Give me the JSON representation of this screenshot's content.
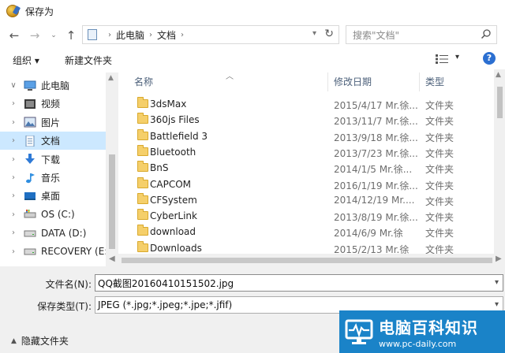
{
  "window": {
    "title": "保存为"
  },
  "address": {
    "segments": [
      "此电脑",
      "文档"
    ]
  },
  "search": {
    "placeholder": "搜索\"文档\""
  },
  "toolbar": {
    "organize_label": "组织 ▾",
    "new_folder_label": "新建文件夹"
  },
  "nav": {
    "items": [
      {
        "label": "此电脑",
        "icon": "pc-icon",
        "selected": false
      },
      {
        "label": "视频",
        "icon": "video-icon",
        "selected": false
      },
      {
        "label": "图片",
        "icon": "pictures-icon",
        "selected": false
      },
      {
        "label": "文档",
        "icon": "documents-icon",
        "selected": true
      },
      {
        "label": "下载",
        "icon": "downloads-icon",
        "selected": false
      },
      {
        "label": "音乐",
        "icon": "music-icon",
        "selected": false
      },
      {
        "label": "桌面",
        "icon": "desktop-icon",
        "selected": false
      },
      {
        "label": "OS (C:)",
        "icon": "os-drive-icon",
        "selected": false
      },
      {
        "label": "DATA (D:)",
        "icon": "drive-icon",
        "selected": false
      },
      {
        "label": "RECOVERY (E:)",
        "icon": "drive-icon",
        "selected": false
      }
    ]
  },
  "columns": {
    "name": "名称",
    "date": "修改日期",
    "type": "类型"
  },
  "files": [
    {
      "name": "3dsMax",
      "date": "2015/4/17 Mr.徐...",
      "type": "文件夹"
    },
    {
      "name": "360js Files",
      "date": "2013/11/7 Mr.徐...",
      "type": "文件夹"
    },
    {
      "name": "Battlefield 3",
      "date": "2013/9/18 Mr.徐...",
      "type": "文件夹"
    },
    {
      "name": "Bluetooth",
      "date": "2013/7/23 Mr.徐...",
      "type": "文件夹"
    },
    {
      "name": "BnS",
      "date": "2014/1/5 Mr.徐...",
      "type": "文件夹"
    },
    {
      "name": "CAPCOM",
      "date": "2016/1/19 Mr.徐...",
      "type": "文件夹"
    },
    {
      "name": "CFSystem",
      "date": "2014/12/19 Mr....",
      "type": "文件夹"
    },
    {
      "name": "CyberLink",
      "date": "2013/8/19 Mr.徐...",
      "type": "文件夹"
    },
    {
      "name": "download",
      "date": "2014/6/9 Mr.徐",
      "type": "文件夹"
    },
    {
      "name": "Downloads",
      "date": "2015/2/13 Mr.徐",
      "type": "文件夹"
    }
  ],
  "save": {
    "filename_label": "文件名(N):",
    "filename_value": "QQ截图20160410151502.jpg",
    "filetype_label": "保存类型(T):",
    "filetype_value": "JPEG (*.jpg;*.jpeg;*.jpe;*.jfif)"
  },
  "hide_folders_label": "隐藏文件夹",
  "watermark": {
    "title": "电脑百科知识",
    "url": "www.pc-daily.com"
  },
  "colors": {
    "selection": "#cce8ff",
    "folder": "#f5cf6a",
    "watermark_bg": "#1a83c8"
  }
}
